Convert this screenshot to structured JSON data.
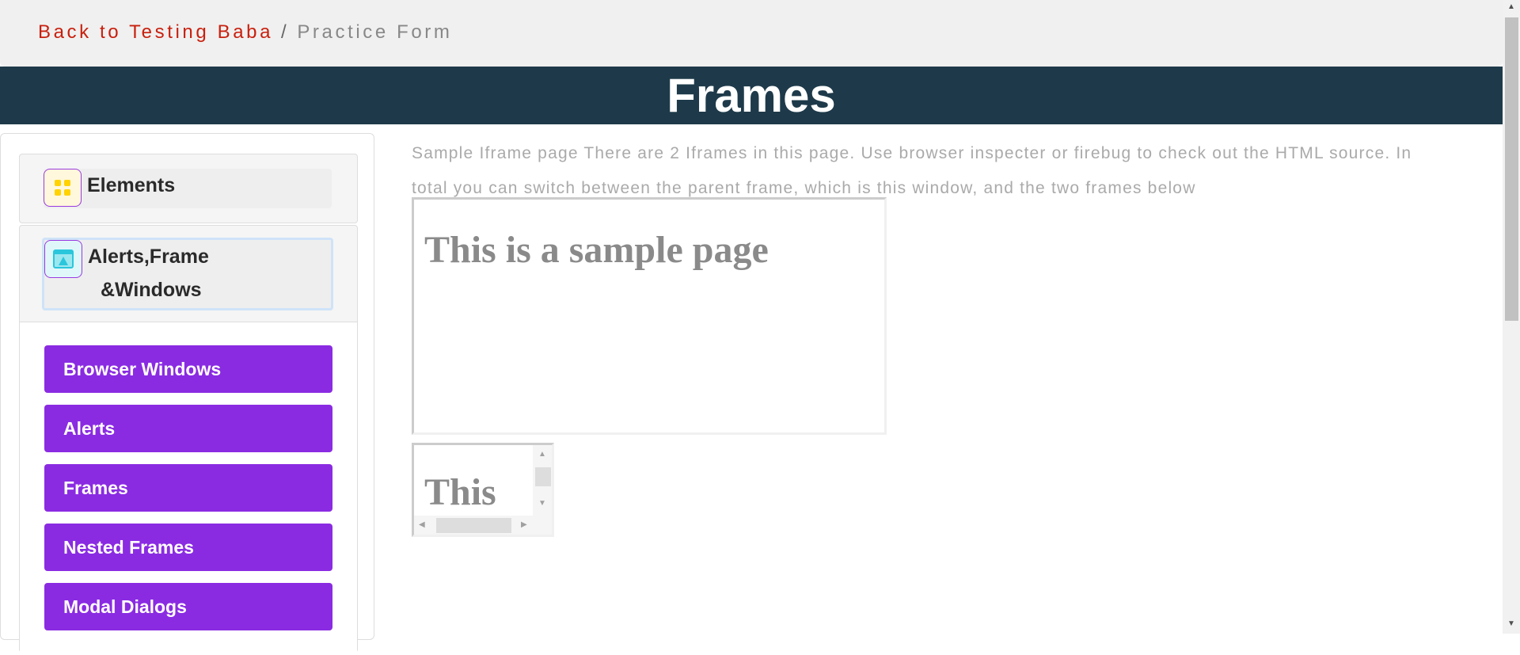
{
  "breadcrumb": {
    "back_link": "Back to Testing Baba",
    "separator": "/",
    "current": "Practice Form"
  },
  "banner": {
    "title": "Frames"
  },
  "sidebar": {
    "groups": [
      {
        "label": "Elements",
        "icon": "grid-icon",
        "icon_color": "#ffd200"
      },
      {
        "label_line1": "Alerts,Frame",
        "label_line2": "&Windows",
        "icon": "alert-window-icon",
        "icon_color": "#2ac6dc"
      }
    ],
    "items": [
      {
        "label": "Browser Windows"
      },
      {
        "label": "Alerts"
      },
      {
        "label": "Frames"
      },
      {
        "label": "Nested Frames"
      },
      {
        "label": "Modal Dialogs"
      }
    ],
    "accent": "#8a2be2"
  },
  "main": {
    "description": "Sample Iframe page There are 2 Iframes in this page. Use browser inspecter or firebug to check out the HTML source. In total you can switch between the parent frame, which is this window, and the two frames below",
    "frame1": {
      "heading": "This is a sample page"
    },
    "frame2": {
      "heading": "This"
    }
  }
}
